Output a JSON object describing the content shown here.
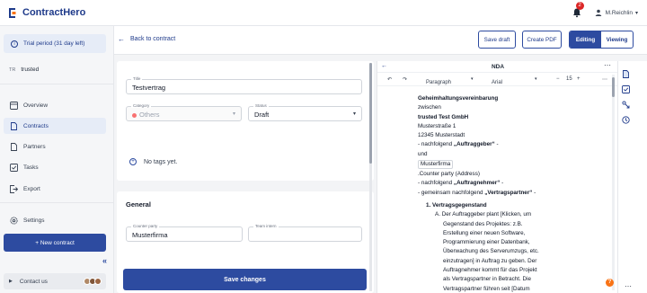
{
  "app": {
    "name": "ContractHero"
  },
  "header": {
    "notifications_count": "2",
    "user_name": "M.Reichlin"
  },
  "sidebar": {
    "trial_text": "Trial period (31 day left)",
    "workspace_badge": "TR",
    "workspace_name": "trusted",
    "nav": [
      {
        "label": "Overview",
        "icon": "overview-icon"
      },
      {
        "label": "Contracts",
        "icon": "contracts-icon"
      },
      {
        "label": "Partners",
        "icon": "partners-icon"
      },
      {
        "label": "Tasks",
        "icon": "tasks-icon"
      },
      {
        "label": "Export",
        "icon": "export-icon"
      },
      {
        "label": "Settings",
        "icon": "settings-icon"
      }
    ],
    "new_contract_label": "+ New contract",
    "contact_label": "Contact us"
  },
  "main_header": {
    "back_label": "Back to contract",
    "save_draft_label": "Save draft",
    "create_pdf_label": "Create PDF",
    "editing_label": "Editing",
    "viewing_label": "Viewing"
  },
  "form": {
    "title_label": "Title",
    "title_value": "Testvertrag",
    "category_label": "Category",
    "category_value": "Others",
    "status_label": "Status",
    "status_value": "Draft",
    "tags_text": "No tags yet.",
    "general_title": "General",
    "counterparty_label": "Counter party",
    "counterparty_value": "Musterfirma",
    "team_label": "Team intern",
    "team_value": "",
    "save_label": "Save changes"
  },
  "editor": {
    "title": "NDA",
    "block_type": "Paragraph",
    "font": "Arial",
    "font_size": "15",
    "lines": {
      "l1": "Geheimhaltungsvereinbarung",
      "l2": "zwischen",
      "l3": "trusted Test GmbH",
      "l4": "Musterstraße 1",
      "l5": "12345 Musterstadt",
      "l6a": "- nachfolgend ",
      "l6b": "„Auftraggeber“",
      "l6c": " -",
      "l7": "und",
      "l8": "Musterfirma",
      "l9": ".Counter party (Address)",
      "l10a": "- nachfolgend ",
      "l10b": "„Auftragnehmer“",
      "l10c": " -",
      "l11a": "- gemeinsam nachfolgend ",
      "l11b": "„Vertragspartner“",
      "l11c": " -",
      "l12": "1. Vertragsgegenstand",
      "l13": "A. Der Auftraggeber plant [Klicken, um",
      "l14": "Gegenstand des Projektes: z.B.",
      "l15": "Erstellung einer neuen Software,",
      "l16": "Programmierung einer Datenbank,",
      "l17": "Überwachung des Serverumzugs, etc.",
      "l18": "einzutragen] in Auftrag zu geben. Der",
      "l19": "Auftragnehmer kommt für das Projekt",
      "l20": "als Vertragspartner in Betracht. Die",
      "l21": "Vertragspartner führen seit [Datum"
    }
  },
  "colors": {
    "primary": "#2d4ba0",
    "accent": "#1e3a8a",
    "badge": "#dc2626",
    "help": "#f97316"
  }
}
